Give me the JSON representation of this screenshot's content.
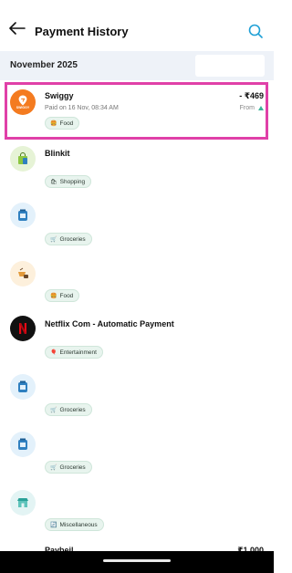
{
  "header": {
    "title": "Payment History",
    "back_icon": "arrow-left-icon",
    "search_icon": "search-icon"
  },
  "month": {
    "label": "November 2025"
  },
  "transactions": [
    {
      "merchant": "Swiggy",
      "subtitle": "Paid on 16 Nov, 08:34 AM",
      "amount": "- ₹469",
      "from": "From",
      "category": "Food",
      "category_icon": "food-icon",
      "logo_icon": "swiggy-logo-icon",
      "logo_label": "SWIGGY",
      "logo_color": "#f47b20",
      "selected": true
    },
    {
      "merchant": "Blinkit",
      "category": "Shopping",
      "category_icon": "shopping-bag-icon",
      "logo_icon": "shopping-bag-icon",
      "logo_color": "#e6f3d6"
    },
    {
      "merchant": "",
      "category": "Groceries",
      "category_icon": "cart-icon",
      "logo_icon": "grocery-jar-icon",
      "logo_color": "#e3f1fb"
    },
    {
      "merchant": "",
      "category": "Food",
      "category_icon": "food-icon",
      "logo_icon": "food-bowl-icon",
      "logo_color": "#fdf0dc"
    },
    {
      "merchant": "Netflix Com - Automatic Payment",
      "category": "Entertainment",
      "category_icon": "balloon-icon",
      "logo_icon": "netflix-logo-icon",
      "logo_color": "#111111"
    },
    {
      "merchant": "",
      "category": "Groceries",
      "category_icon": "cart-icon",
      "logo_icon": "grocery-jar-icon",
      "logo_color": "#e3f1fb"
    },
    {
      "merchant": "",
      "category": "Groceries",
      "category_icon": "cart-icon",
      "logo_icon": "grocery-jar-icon",
      "logo_color": "#e3f1fb"
    },
    {
      "merchant": "",
      "category": "Miscellaneous",
      "category_icon": "refresh-icon",
      "logo_icon": "store-icon",
      "logo_color": "#e3f4f4"
    },
    {
      "merchant": "Paybeil",
      "amount": "₹1,000",
      "logo_icon": "generic-logo-icon",
      "logo_color": "#f2f2f2"
    }
  ],
  "colors": {
    "accent": "#1fa0d6",
    "highlight": "#e040a8",
    "tag_bg": "#e8f4ee",
    "swiggy": "#f47b20"
  }
}
